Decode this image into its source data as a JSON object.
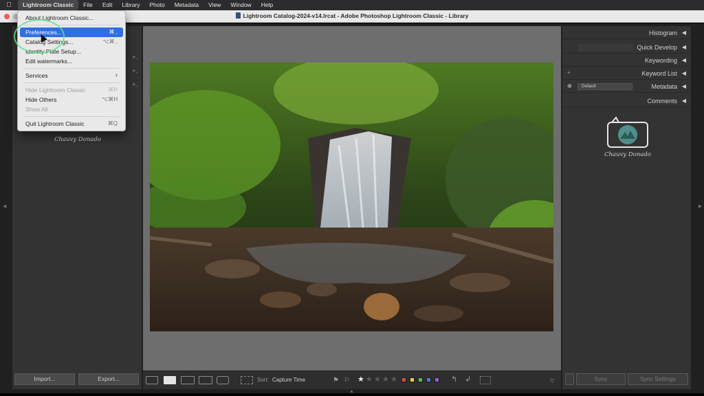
{
  "menubar": {
    "items": [
      "Lightroom Classic",
      "File",
      "Edit",
      "Library",
      "Photo",
      "Metadata",
      "View",
      "Window",
      "Help"
    ]
  },
  "window": {
    "title": "Lightroom Catalog-2024-v14.lrcat - Adobe Photoshop Lightroom Classic - Library"
  },
  "app_menu": {
    "items": [
      {
        "label": "About Lightroom Classic...",
        "shortcut": "",
        "state": "normal"
      },
      {
        "label": "Preferences...",
        "shortcut": "⌘ ,",
        "state": "highlight"
      },
      {
        "label": "Catalog Settings...",
        "shortcut": "⌥⌘ ,",
        "state": "normal"
      },
      {
        "label": "Identity Plate Setup...",
        "shortcut": "",
        "state": "normal"
      },
      {
        "label": "Edit watermarks...",
        "shortcut": "",
        "state": "normal"
      },
      {
        "label": "Services",
        "shortcut": "›",
        "state": "normal"
      },
      {
        "label": "Hide Lightroom Classic",
        "shortcut": "⌘H",
        "state": "disabled"
      },
      {
        "label": "Hide Others",
        "shortcut": "⌥⌘H",
        "state": "normal"
      },
      {
        "label": "Show All",
        "shortcut": "",
        "state": "disabled"
      },
      {
        "label": "Quit Lightroom Classic",
        "shortcut": "⌘Q",
        "state": "normal"
      }
    ]
  },
  "left_panel": {
    "signature": "Chauvy Donado",
    "import_label": "Import...",
    "export_label": "Export..."
  },
  "toolbar": {
    "sort_label": "Sort:",
    "sort_value": "Capture Time",
    "rating": 1,
    "max_rating": 5,
    "color_labels": [
      "#d94a4a",
      "#e6d24a",
      "#5cbf4a",
      "#4a7ed9",
      "#9a5cd9"
    ]
  },
  "right_panel": {
    "sections": [
      "Histogram",
      "Quick Develop",
      "Keywording",
      "Keyword List",
      "Metadata",
      "Comments"
    ],
    "metadata_preset": "Default",
    "signature": "Chauvy Donado",
    "sync_label": "Sync",
    "sync_settings_label": "Sync Settings"
  }
}
